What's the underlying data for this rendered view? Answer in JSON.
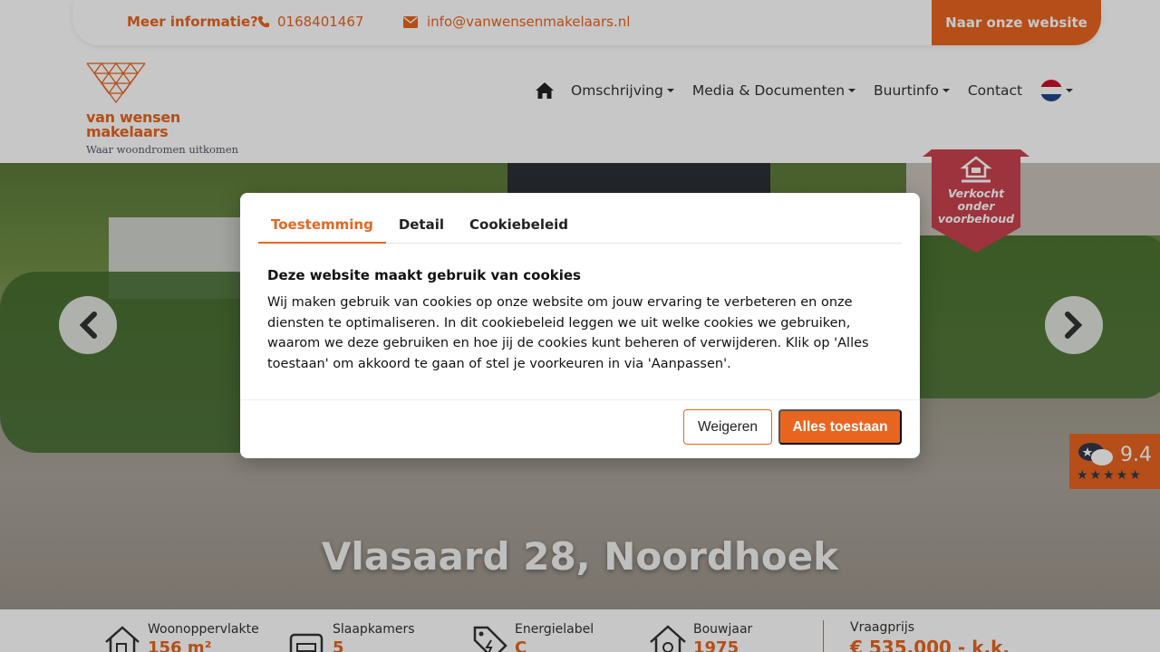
{
  "topbar": {
    "info_label": "Meer informatie?",
    "phone": "0168401467",
    "email": "info@vanwensenmakelaars.nl",
    "website_button": "Naar onze website"
  },
  "logo": {
    "name_line1": "van wensen",
    "name_line2": "makelaars",
    "tagline": "Waar woondromen uitkomen"
  },
  "nav": {
    "items": [
      {
        "label": "Omschrijving",
        "dropdown": true
      },
      {
        "label": "Media & Documenten",
        "dropdown": true
      },
      {
        "label": "Buurtinfo",
        "dropdown": true
      },
      {
        "label": "Contact",
        "dropdown": false
      }
    ],
    "language": "nl"
  },
  "hero": {
    "title": "Vlasaard 28, Noordhoek",
    "ribbon_line1": "Verkocht",
    "ribbon_line2": "onder",
    "ribbon_line3": "voorbehoud"
  },
  "rating": {
    "score": "9.4",
    "stars": "★★★★★"
  },
  "stats": {
    "items": [
      {
        "label": "Woonoppervlakte",
        "value": "156 m²",
        "icon": "floor-area-icon"
      },
      {
        "label": "Slaapkamers",
        "value": "5",
        "icon": "bed-icon"
      },
      {
        "label": "Energielabel",
        "value": "C",
        "icon": "energy-tag-icon"
      },
      {
        "label": "Bouwjaar",
        "value": "1975",
        "icon": "builder-house-icon"
      }
    ],
    "price_label": "Vraagprijs",
    "price_value": "€ 535.000 - k.k."
  },
  "cookie_modal": {
    "tabs": [
      "Toestemming",
      "Detail",
      "Cookiebeleid"
    ],
    "active_tab": "Toestemming",
    "heading": "Deze website maakt gebruik van cookies",
    "body": "Wij maken gebruik van cookies op onze website om jouw ervaring te verbeteren en onze diensten te optimaliseren. In dit cookiebeleid leggen we uit welke cookies we gebruiken, waarom we deze gebruiken en hoe jij de cookies kunt beheren of verwijderen. Klik op 'Alles toestaan' om akkoord te gaan of stel je voorkeuren in via 'Aanpassen'.",
    "decline_label": "Weigeren",
    "accept_label": "Alles toestaan"
  },
  "colors": {
    "accent": "#e8651f",
    "ribbon": "#c9424d",
    "text": "#333333"
  }
}
